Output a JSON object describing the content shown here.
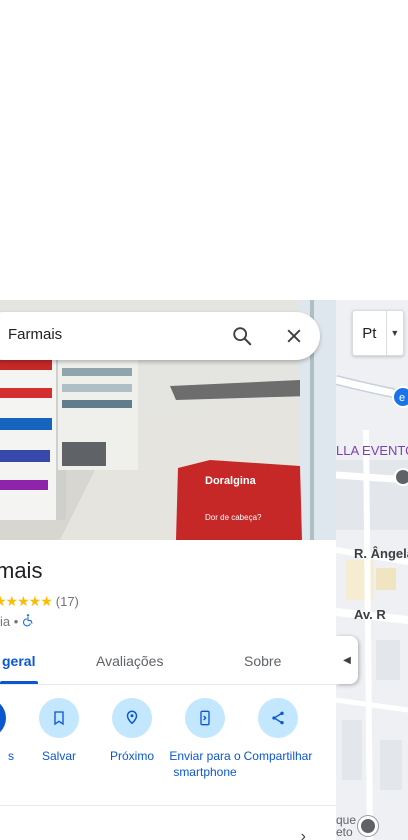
{
  "search": {
    "query": "Farmais"
  },
  "map": {
    "layer_label": "Pt",
    "poi_label": "LLA EVENTO",
    "street_1": "R. Ângela",
    "street_2": "Av. R",
    "bottom_label": "que\neto"
  },
  "place": {
    "title": "mais",
    "rating_count": "(17)",
    "category_suffix": "ia •"
  },
  "tabs": [
    {
      "label": "geral"
    },
    {
      "label": "Avaliações"
    },
    {
      "label": "Sobre"
    }
  ],
  "actions": [
    {
      "label": "s"
    },
    {
      "label": "Salvar"
    },
    {
      "label": "Próximo"
    },
    {
      "label": "Enviar para o smartphone"
    },
    {
      "label": "Compartilhar"
    }
  ],
  "colors": {
    "accent": "#0b57d0",
    "chip": "#c2e7ff",
    "star": "#fbbc04"
  }
}
